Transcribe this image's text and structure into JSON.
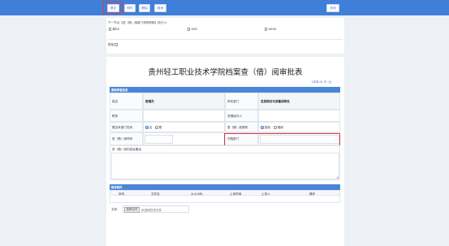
{
  "toolbar": {
    "save": "提交",
    "attach": "附件",
    "del": "删除",
    "back": "取消",
    "close": "关闭"
  },
  "workflow": {
    "next_step_prefix": "下一节点【查（借）阅部门领导审核】执行人：",
    "user_a": "周XX",
    "user_b": "XXX",
    "user_c": "XXXX",
    "sms_label": "短信"
  },
  "form": {
    "title": "贵州轻工职业技术学院档案查（借）阅审批表",
    "font_label": "[字体:",
    "font_large": "大",
    "font_mid": "中",
    "font_small": "小",
    "font_end": "]",
    "section_basic": "基础审查信息",
    "name_label": "姓名",
    "name_value": "管理员",
    "dept_label": "所在部门",
    "dept_value": "发展规划与质量保障处",
    "position_label": "职务",
    "position_value": "",
    "handler_label": "查借经办人",
    "handler_value": "",
    "isdept_label": "是否本部门在岗",
    "yes": "否",
    "no": "是",
    "type_label": "查（借）阅类别",
    "type_a": "查阅",
    "type_b": "借阅",
    "time_label": "查（借）阅时间",
    "time_value": "",
    "archive_dept_label": "归档部门",
    "archive_dept_value": "",
    "content_label": "查（借）阅内容及事由",
    "content_value": "",
    "section_attach": "附件附件",
    "attach_cols": [
      "序号",
      "文件名",
      "大小(KB)",
      "上传时间",
      "上传人",
      "操作"
    ],
    "upload_label": "文件:",
    "choose_file": "选择文件",
    "no_file": "未选择任何文件"
  },
  "colors": {
    "accent": "#3f7fd9",
    "highlight_red": "#e03a3a"
  }
}
